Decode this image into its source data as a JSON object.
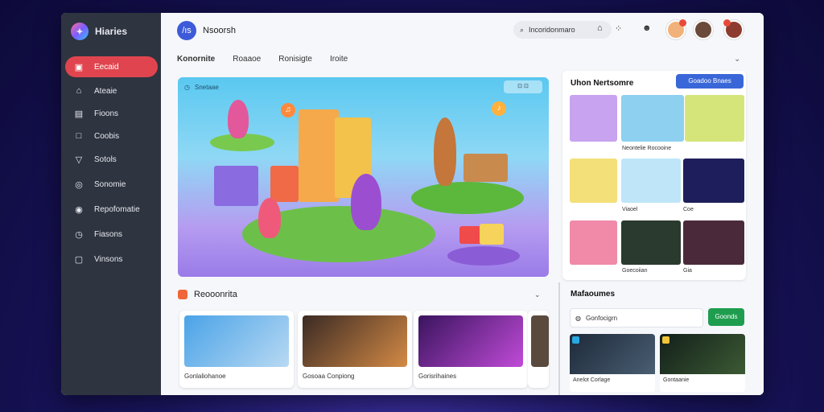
{
  "brand": {
    "name": "Hiaries",
    "logo_icon": "sparkle-logo-icon"
  },
  "sidebar": {
    "items": [
      {
        "label": "Eecaid",
        "icon": "folder-icon",
        "active": true
      },
      {
        "label": "Ateaie",
        "icon": "home-icon",
        "active": false
      },
      {
        "label": "Fioons",
        "icon": "book-icon",
        "active": false
      },
      {
        "label": "Coobis",
        "icon": "square-icon",
        "active": false
      },
      {
        "label": "Sotols",
        "icon": "filter-icon",
        "active": false
      },
      {
        "label": "Sonomie",
        "icon": "compass-icon",
        "active": false
      },
      {
        "label": "Repofomatie",
        "icon": "user-circle-icon",
        "active": false
      },
      {
        "label": "Fiasons",
        "icon": "clock-icon",
        "active": false
      },
      {
        "label": "Vinsons",
        "icon": "chat-icon",
        "active": false
      }
    ]
  },
  "header": {
    "title": "Nsoorsh",
    "app_icon_text": "/ıs",
    "search_value": "Incoridonmaro",
    "icons": [
      "search-icon",
      "lock-icon",
      "dots-grid-icon",
      "bell-icon"
    ]
  },
  "tabs": [
    "Konornite",
    "Roaaoe",
    "Ronisigte",
    "Iroite"
  ],
  "hero": {
    "label": "Snetaae",
    "control": "⊡ ⊡"
  },
  "recommendations": {
    "title": "Reooonrita",
    "cards": [
      {
        "caption": "Gonlaliohanoe"
      },
      {
        "caption": "Gosoaa Conpiong"
      },
      {
        "caption": "Gorisrihaines"
      },
      {
        "caption": ""
      }
    ]
  },
  "right_panel": {
    "title": "Uhon Nertsomre",
    "button": "Goadoo Bnaes",
    "captions": [
      "Neontelie Rocooine",
      "Viaoel",
      "Coe",
      "Goecoiian",
      "Gia"
    ]
  },
  "more": {
    "title": "Mafaoumes",
    "input_value": "Gonfocigrn",
    "button": "Goonds",
    "cards": [
      {
        "caption": "Anelot Corlage"
      },
      {
        "caption": "Gontaanie"
      }
    ]
  },
  "colors": {
    "accent_red": "#e0454f",
    "accent_blue": "#3a67d8",
    "accent_green": "#1f9d4f",
    "sidebar_bg": "#2e3440"
  }
}
